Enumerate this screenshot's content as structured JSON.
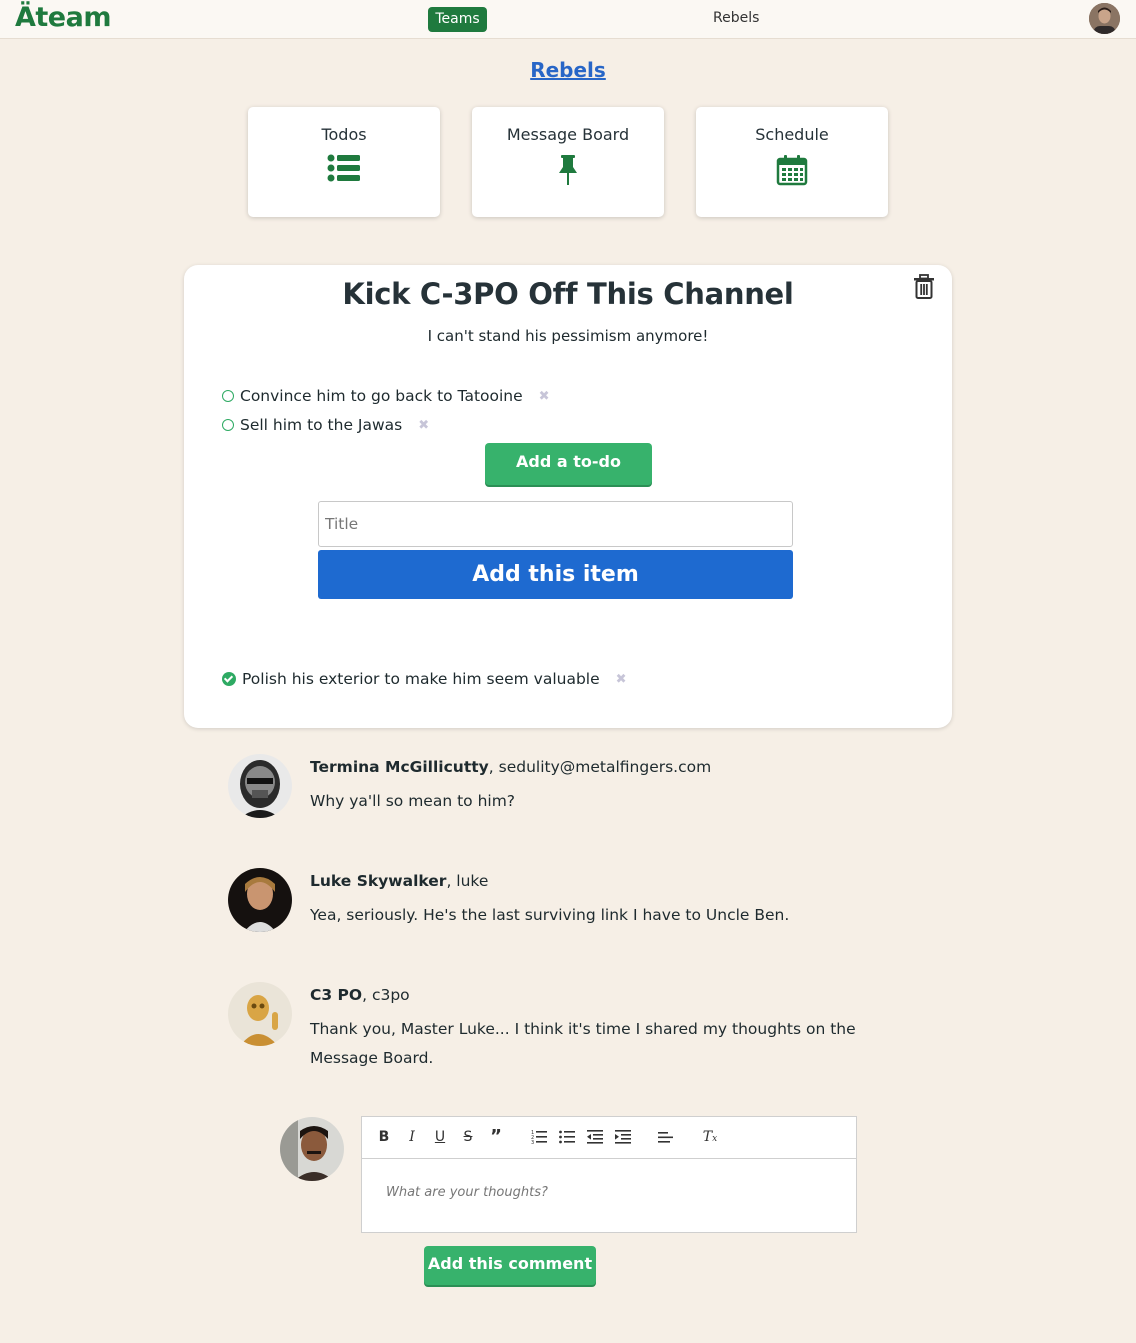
{
  "nav": {
    "logo": "Äteam",
    "teams_label": "Teams",
    "current_team": "Rebels"
  },
  "team": {
    "title": "Rebels"
  },
  "tools": [
    {
      "label": "Todos",
      "icon": "list-icon"
    },
    {
      "label": "Message Board",
      "icon": "pushpin-icon"
    },
    {
      "label": "Schedule",
      "icon": "calendar-icon"
    }
  ],
  "todo_list": {
    "title": "Kick C-3PO Off This Channel",
    "description": "I can't stand his pessimism anymore!",
    "open_items": [
      {
        "text": "Convince him to go back to Tatooine"
      },
      {
        "text": "Sell him to the Jawas"
      }
    ],
    "done_items": [
      {
        "text": "Polish his exterior to make him seem valuable"
      }
    ],
    "add_todo_label": "Add a to-do",
    "input_placeholder": "Title",
    "add_item_label": "Add this item",
    "delete_glyph": "✖"
  },
  "comments": [
    {
      "name": "Termina McGillicutty",
      "handle": ", sedulity@metalfingers.com",
      "body": "Why ya'll so mean to him?"
    },
    {
      "name": "Luke Skywalker",
      "handle": ", luke",
      "body": "Yea, seriously. He's the last surviving link I have to Uncle Ben."
    },
    {
      "name": "C3 PO",
      "handle": ", c3po",
      "body": "Thank you, Master Luke... I think it's time I shared my thoughts on the Message Board."
    }
  ],
  "composer": {
    "placeholder": "What are your thoughts?",
    "submit_label": "Add this comment",
    "toolbar": [
      "bold-icon",
      "italic-icon",
      "underline-icon",
      "strike-icon",
      "quote-icon",
      "ordered-list-icon",
      "bullet-list-icon",
      "outdent-icon",
      "indent-icon",
      "align-icon",
      "clear-format-icon"
    ]
  },
  "colors": {
    "brand_green": "#1f7a3e",
    "button_green": "#37b26c",
    "primary_blue": "#1e6ad0",
    "background": "#f6efe6"
  }
}
